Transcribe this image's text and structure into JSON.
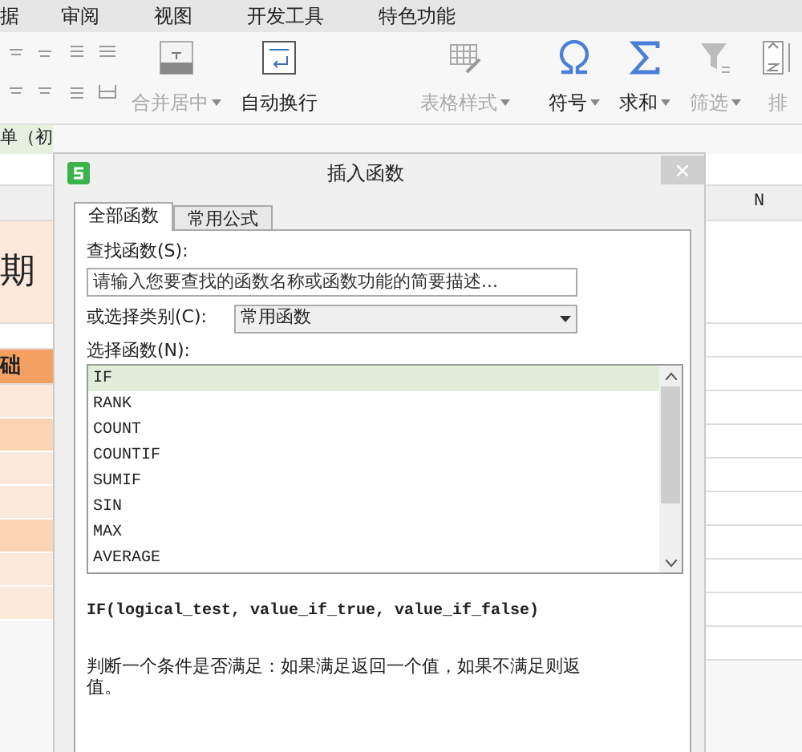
{
  "menu": [
    {
      "label": "据"
    },
    {
      "label": "审阅"
    },
    {
      "label": "视图"
    },
    {
      "label": "开发工具"
    },
    {
      "label": "特色功能"
    }
  ],
  "toolbar": [
    {
      "kind": "merge",
      "label": "合并居中",
      "disabled": true,
      "dropdown": true
    },
    {
      "kind": "wrap",
      "label": "自动换行",
      "disabled": false,
      "dropdown": false
    },
    {
      "kind": "table",
      "label": "表格样式",
      "disabled": true,
      "dropdown": true
    },
    {
      "kind": "omega",
      "label": "符号",
      "disabled": false,
      "dropdown": true
    },
    {
      "kind": "sigma",
      "label": "求和",
      "disabled": false,
      "dropdown": true
    },
    {
      "kind": "filter",
      "label": "筛选",
      "disabled": true,
      "dropdown": true
    },
    {
      "kind": "sort",
      "label": "排",
      "disabled": true,
      "dropdown": false
    }
  ],
  "sheet_tab": {
    "label": "单（初"
  },
  "sheet": {
    "cells": [
      {
        "text": "期",
        "kind": "title"
      },
      {
        "text": "础",
        "kind": "header"
      }
    ],
    "column_header": "N"
  },
  "dialog": {
    "title": "插入函数",
    "tabs": [
      {
        "label": "全部函数",
        "selected": true
      },
      {
        "label": "常用公式",
        "selected": false
      }
    ],
    "search_label": "查找函数(S):",
    "search": {
      "value": "请输入您要查找的函数名称或函数功能的简要描述..."
    },
    "category_label": "或选择类别(C):",
    "category": {
      "value": "常用函数"
    },
    "list_label": "选择函数(N):",
    "functions": [
      {
        "name": "IF",
        "selected": true
      },
      {
        "name": "RANK",
        "selected": false
      },
      {
        "name": "COUNT",
        "selected": false
      },
      {
        "name": "COUNTIF",
        "selected": false
      },
      {
        "name": "SUMIF",
        "selected": false
      },
      {
        "name": "SIN",
        "selected": false
      },
      {
        "name": "MAX",
        "selected": false
      },
      {
        "name": "AVERAGE",
        "selected": false
      }
    ],
    "syntax": "IF(logical_test, value_if_true, value_if_false)",
    "description": [
      "判断一个条件是否满足：如果满足返回一个值，如果不满足则返",
      "值。"
    ]
  }
}
